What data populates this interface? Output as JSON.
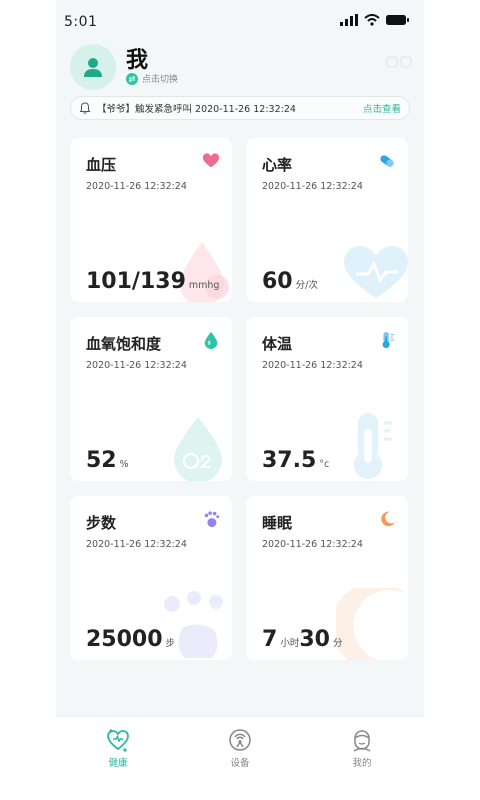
{
  "status": {
    "time": "5:01"
  },
  "header": {
    "user_name": "我",
    "switch_label": "点击切换"
  },
  "alert": {
    "message": "【爷爷】触发紧急呼叫 2020-11-26 12:32:24",
    "action": "点击查看"
  },
  "cards": [
    {
      "title": "血压",
      "time": "2020-11-26 12:32:24",
      "value": "101/139",
      "unit": "mmhg",
      "icon": "heart-icon",
      "accent": "#f06b8c"
    },
    {
      "title": "心率",
      "time": "2020-11-26 12:32:24",
      "value": "60",
      "unit": "分/次",
      "icon": "pill-icon",
      "accent": "#2aa5e6"
    },
    {
      "title": "血氧饱和度",
      "time": "2020-11-26 12:32:24",
      "value": "52",
      "unit": "%",
      "icon": "drop-icon",
      "accent": "#2ec4a6"
    },
    {
      "title": "体温",
      "time": "2020-11-26 12:32:24",
      "value": "37.5",
      "unit": "°c",
      "icon": "thermometer-icon",
      "accent": "#2aa5e6"
    },
    {
      "title": "步数",
      "time": "2020-11-26 12:32:24",
      "value": "25000",
      "unit": "步",
      "icon": "footprint-icon",
      "accent": "#8f86ee"
    },
    {
      "title": "睡眠",
      "time": "2020-11-26 12:32:24",
      "value_hours": "7",
      "unit_hours": "小时",
      "value_minutes": "30",
      "unit_minutes": "分",
      "icon": "moon-icon",
      "accent": "#f39a57"
    }
  ],
  "tabs": [
    {
      "label": "健康",
      "icon": "health-icon",
      "active": true
    },
    {
      "label": "设备",
      "icon": "device-icon",
      "active": false
    },
    {
      "label": "我的",
      "icon": "profile-icon",
      "active": false
    }
  ],
  "colors": {
    "brand": "#2bb89c",
    "background": "#f3f7f7",
    "card": "#ffffff"
  }
}
